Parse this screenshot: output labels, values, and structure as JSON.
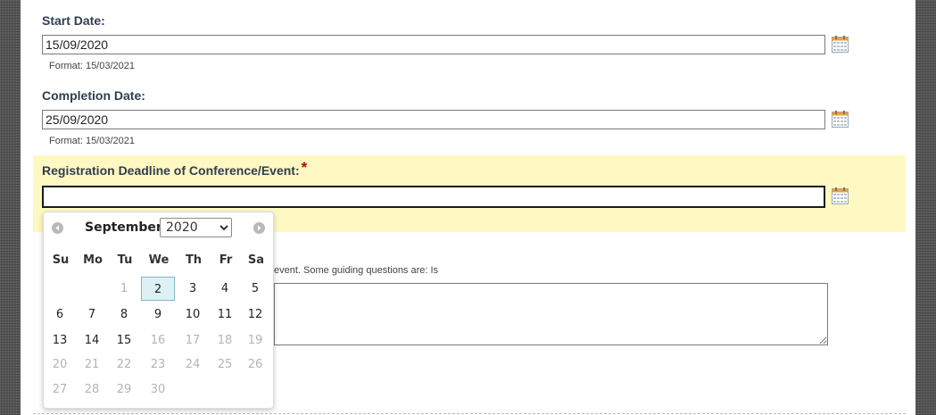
{
  "form": {
    "start_date": {
      "label": "Start Date:",
      "value": "15/09/2020",
      "format_hint": "Format: 15/03/2021"
    },
    "completion_date": {
      "label": "Completion Date:",
      "value": "25/09/2020",
      "format_hint": "Format: 15/03/2021"
    },
    "registration_deadline": {
      "label": "Registration Deadline of Conference/Event:",
      "required_mark": "*",
      "value": ""
    },
    "description_hint": "event. Some guiding questions are: Is",
    "description_value": ""
  },
  "datepicker": {
    "month": "September",
    "year_selected": "2020",
    "weekday_headers": [
      "Su",
      "Mo",
      "Tu",
      "We",
      "Th",
      "Fr",
      "Sa"
    ],
    "weeks": [
      [
        {
          "d": "",
          "s": "empty"
        },
        {
          "d": "",
          "s": "empty"
        },
        {
          "d": "1",
          "s": "muted"
        },
        {
          "d": "2",
          "s": "today"
        },
        {
          "d": "3",
          "s": "normal"
        },
        {
          "d": "4",
          "s": "normal"
        },
        {
          "d": "5",
          "s": "normal"
        }
      ],
      [
        {
          "d": "6",
          "s": "normal"
        },
        {
          "d": "7",
          "s": "normal"
        },
        {
          "d": "8",
          "s": "normal"
        },
        {
          "d": "9",
          "s": "normal"
        },
        {
          "d": "10",
          "s": "normal"
        },
        {
          "d": "11",
          "s": "normal"
        },
        {
          "d": "12",
          "s": "normal"
        }
      ],
      [
        {
          "d": "13",
          "s": "normal"
        },
        {
          "d": "14",
          "s": "normal"
        },
        {
          "d": "15",
          "s": "normal"
        },
        {
          "d": "16",
          "s": "muted"
        },
        {
          "d": "17",
          "s": "muted"
        },
        {
          "d": "18",
          "s": "muted"
        },
        {
          "d": "19",
          "s": "muted"
        }
      ],
      [
        {
          "d": "20",
          "s": "muted"
        },
        {
          "d": "21",
          "s": "muted"
        },
        {
          "d": "22",
          "s": "muted"
        },
        {
          "d": "23",
          "s": "muted"
        },
        {
          "d": "24",
          "s": "muted"
        },
        {
          "d": "25",
          "s": "muted"
        },
        {
          "d": "26",
          "s": "muted"
        }
      ],
      [
        {
          "d": "27",
          "s": "muted"
        },
        {
          "d": "28",
          "s": "muted"
        },
        {
          "d": "29",
          "s": "muted"
        },
        {
          "d": "30",
          "s": "muted"
        },
        {
          "d": "",
          "s": "empty"
        },
        {
          "d": "",
          "s": "empty"
        },
        {
          "d": "",
          "s": "empty"
        }
      ]
    ]
  },
  "icons": {
    "calendar": "calendar-icon",
    "prev": "prev-month-icon",
    "next": "next-month-icon"
  },
  "colors": {
    "highlight": "#fff8c2",
    "required": "#c00000",
    "label": "#2f3e4e",
    "today_bg": "#dff0f4"
  }
}
